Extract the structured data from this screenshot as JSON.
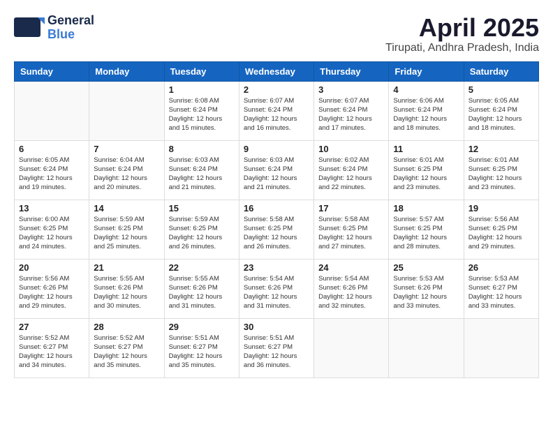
{
  "header": {
    "logo_general": "General",
    "logo_blue": "Blue",
    "month": "April 2025",
    "location": "Tirupati, Andhra Pradesh, India"
  },
  "days_of_week": [
    "Sunday",
    "Monday",
    "Tuesday",
    "Wednesday",
    "Thursday",
    "Friday",
    "Saturday"
  ],
  "weeks": [
    [
      {
        "day": "",
        "info": ""
      },
      {
        "day": "",
        "info": ""
      },
      {
        "day": "1",
        "info": "Sunrise: 6:08 AM\nSunset: 6:24 PM\nDaylight: 12 hours\nand 15 minutes."
      },
      {
        "day": "2",
        "info": "Sunrise: 6:07 AM\nSunset: 6:24 PM\nDaylight: 12 hours\nand 16 minutes."
      },
      {
        "day": "3",
        "info": "Sunrise: 6:07 AM\nSunset: 6:24 PM\nDaylight: 12 hours\nand 17 minutes."
      },
      {
        "day": "4",
        "info": "Sunrise: 6:06 AM\nSunset: 6:24 PM\nDaylight: 12 hours\nand 18 minutes."
      },
      {
        "day": "5",
        "info": "Sunrise: 6:05 AM\nSunset: 6:24 PM\nDaylight: 12 hours\nand 18 minutes."
      }
    ],
    [
      {
        "day": "6",
        "info": "Sunrise: 6:05 AM\nSunset: 6:24 PM\nDaylight: 12 hours\nand 19 minutes."
      },
      {
        "day": "7",
        "info": "Sunrise: 6:04 AM\nSunset: 6:24 PM\nDaylight: 12 hours\nand 20 minutes."
      },
      {
        "day": "8",
        "info": "Sunrise: 6:03 AM\nSunset: 6:24 PM\nDaylight: 12 hours\nand 21 minutes."
      },
      {
        "day": "9",
        "info": "Sunrise: 6:03 AM\nSunset: 6:24 PM\nDaylight: 12 hours\nand 21 minutes."
      },
      {
        "day": "10",
        "info": "Sunrise: 6:02 AM\nSunset: 6:24 PM\nDaylight: 12 hours\nand 22 minutes."
      },
      {
        "day": "11",
        "info": "Sunrise: 6:01 AM\nSunset: 6:25 PM\nDaylight: 12 hours\nand 23 minutes."
      },
      {
        "day": "12",
        "info": "Sunrise: 6:01 AM\nSunset: 6:25 PM\nDaylight: 12 hours\nand 23 minutes."
      }
    ],
    [
      {
        "day": "13",
        "info": "Sunrise: 6:00 AM\nSunset: 6:25 PM\nDaylight: 12 hours\nand 24 minutes."
      },
      {
        "day": "14",
        "info": "Sunrise: 5:59 AM\nSunset: 6:25 PM\nDaylight: 12 hours\nand 25 minutes."
      },
      {
        "day": "15",
        "info": "Sunrise: 5:59 AM\nSunset: 6:25 PM\nDaylight: 12 hours\nand 26 minutes."
      },
      {
        "day": "16",
        "info": "Sunrise: 5:58 AM\nSunset: 6:25 PM\nDaylight: 12 hours\nand 26 minutes."
      },
      {
        "day": "17",
        "info": "Sunrise: 5:58 AM\nSunset: 6:25 PM\nDaylight: 12 hours\nand 27 minutes."
      },
      {
        "day": "18",
        "info": "Sunrise: 5:57 AM\nSunset: 6:25 PM\nDaylight: 12 hours\nand 28 minutes."
      },
      {
        "day": "19",
        "info": "Sunrise: 5:56 AM\nSunset: 6:25 PM\nDaylight: 12 hours\nand 29 minutes."
      }
    ],
    [
      {
        "day": "20",
        "info": "Sunrise: 5:56 AM\nSunset: 6:26 PM\nDaylight: 12 hours\nand 29 minutes."
      },
      {
        "day": "21",
        "info": "Sunrise: 5:55 AM\nSunset: 6:26 PM\nDaylight: 12 hours\nand 30 minutes."
      },
      {
        "day": "22",
        "info": "Sunrise: 5:55 AM\nSunset: 6:26 PM\nDaylight: 12 hours\nand 31 minutes."
      },
      {
        "day": "23",
        "info": "Sunrise: 5:54 AM\nSunset: 6:26 PM\nDaylight: 12 hours\nand 31 minutes."
      },
      {
        "day": "24",
        "info": "Sunrise: 5:54 AM\nSunset: 6:26 PM\nDaylight: 12 hours\nand 32 minutes."
      },
      {
        "day": "25",
        "info": "Sunrise: 5:53 AM\nSunset: 6:26 PM\nDaylight: 12 hours\nand 33 minutes."
      },
      {
        "day": "26",
        "info": "Sunrise: 5:53 AM\nSunset: 6:27 PM\nDaylight: 12 hours\nand 33 minutes."
      }
    ],
    [
      {
        "day": "27",
        "info": "Sunrise: 5:52 AM\nSunset: 6:27 PM\nDaylight: 12 hours\nand 34 minutes."
      },
      {
        "day": "28",
        "info": "Sunrise: 5:52 AM\nSunset: 6:27 PM\nDaylight: 12 hours\nand 35 minutes."
      },
      {
        "day": "29",
        "info": "Sunrise: 5:51 AM\nSunset: 6:27 PM\nDaylight: 12 hours\nand 35 minutes."
      },
      {
        "day": "30",
        "info": "Sunrise: 5:51 AM\nSunset: 6:27 PM\nDaylight: 12 hours\nand 36 minutes."
      },
      {
        "day": "",
        "info": ""
      },
      {
        "day": "",
        "info": ""
      },
      {
        "day": "",
        "info": ""
      }
    ]
  ]
}
